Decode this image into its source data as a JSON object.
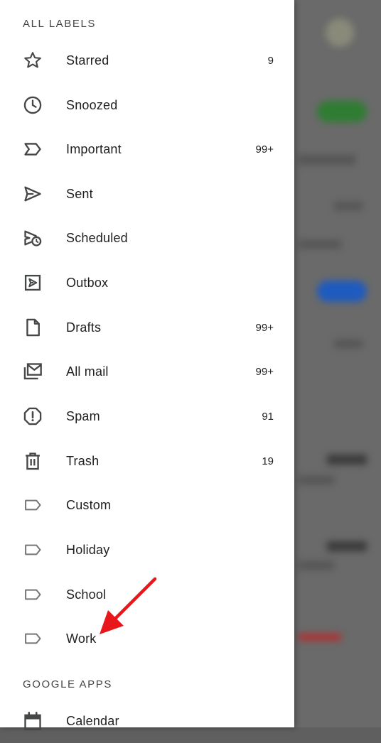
{
  "sections": {
    "all_labels": "ALL LABELS",
    "google_apps": "GOOGLE APPS"
  },
  "labels": [
    {
      "label": "Starred",
      "count": "9",
      "icon": "star-icon"
    },
    {
      "label": "Snoozed",
      "count": "",
      "icon": "clock-icon"
    },
    {
      "label": "Important",
      "count": "99+",
      "icon": "important-icon"
    },
    {
      "label": "Sent",
      "count": "",
      "icon": "send-icon"
    },
    {
      "label": "Scheduled",
      "count": "",
      "icon": "scheduled-send-icon"
    },
    {
      "label": "Outbox",
      "count": "",
      "icon": "outbox-icon"
    },
    {
      "label": "Drafts",
      "count": "99+",
      "icon": "draft-icon"
    },
    {
      "label": "All mail",
      "count": "99+",
      "icon": "all-mail-icon"
    },
    {
      "label": "Spam",
      "count": "91",
      "icon": "spam-icon"
    },
    {
      "label": "Trash",
      "count": "19",
      "icon": "trash-icon"
    },
    {
      "label": "Custom",
      "count": "",
      "icon": "label-icon"
    },
    {
      "label": "Holiday",
      "count": "",
      "icon": "label-icon"
    },
    {
      "label": "School",
      "count": "",
      "icon": "label-icon"
    },
    {
      "label": "Work",
      "count": "",
      "icon": "label-icon"
    }
  ],
  "apps": [
    {
      "label": "Calendar",
      "icon": "calendar-icon"
    }
  ],
  "colors": {
    "annotation_arrow": "#e8171c",
    "drawer_bg": "#ffffff",
    "scrim": "#5f5f5f"
  }
}
